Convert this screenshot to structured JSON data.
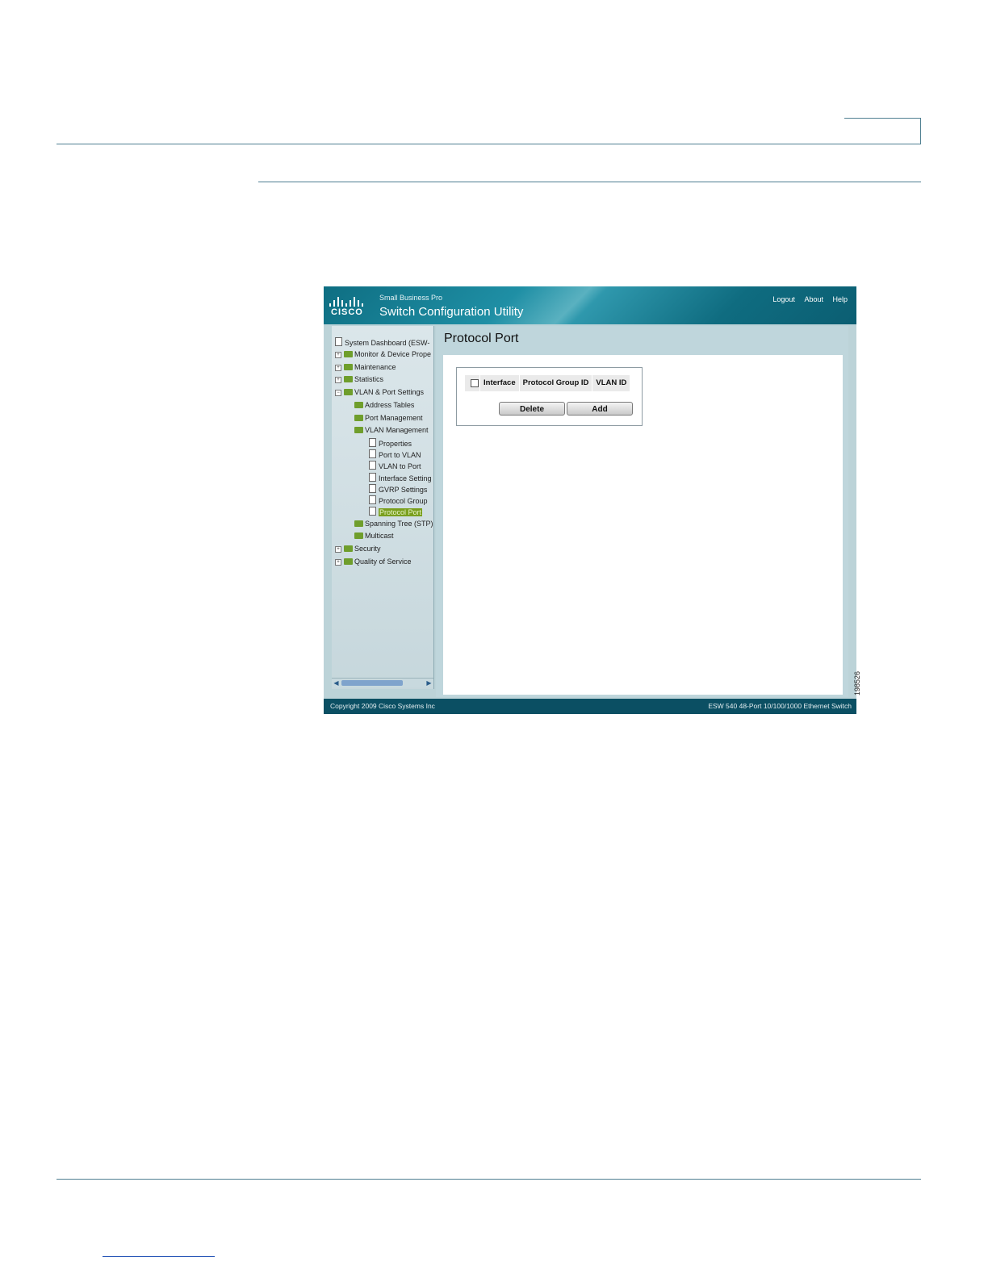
{
  "app": {
    "brand_top": "Small Business Pro",
    "brand_title": "Switch Configuration Utility",
    "logo_text": "CISCO",
    "links": [
      "Logout",
      "About",
      "Help"
    ]
  },
  "nav": {
    "items": [
      {
        "label": "System Dashboard (ESW-"
      },
      {
        "label": "Monitor & Device Prope"
      },
      {
        "label": "Maintenance"
      },
      {
        "label": "Statistics"
      },
      {
        "label": "VLAN & Port Settings"
      },
      {
        "label": "Address Tables"
      },
      {
        "label": "Port Management"
      },
      {
        "label": "VLAN Management"
      },
      {
        "label": "Properties"
      },
      {
        "label": "Port to VLAN"
      },
      {
        "label": "VLAN to Port"
      },
      {
        "label": "Interface Setting"
      },
      {
        "label": "GVRP Settings"
      },
      {
        "label": "Protocol Group"
      },
      {
        "label": "Protocol Port"
      },
      {
        "label": "Spanning Tree (STP)"
      },
      {
        "label": "Multicast"
      },
      {
        "label": "Security"
      },
      {
        "label": "Quality of Service"
      }
    ],
    "selected": "Protocol Port"
  },
  "content": {
    "title": "Protocol Port",
    "columns": [
      "Interface",
      "Protocol Group ID",
      "VLAN ID"
    ],
    "delete_label": "Delete",
    "add_label": "Add"
  },
  "footer": {
    "copyright": "Copyright 2009 Cisco Systems Inc",
    "model": "ESW 540 48-Port 10/100/1000 Ethernet Switch"
  },
  "figure_number": "198526",
  "colors": {
    "header": "#0e6e82",
    "nav_selected": "#7a9f1e",
    "folder": "#6f9e2c",
    "rule": "#4f7f91"
  }
}
